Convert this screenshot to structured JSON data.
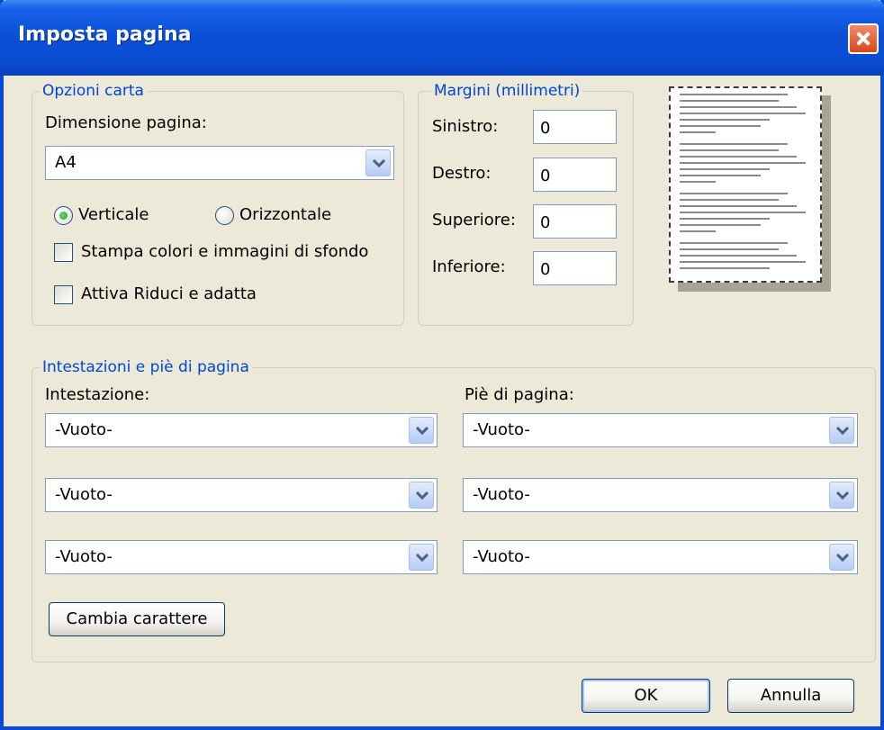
{
  "window": {
    "title": "Imposta pagina"
  },
  "paper": {
    "legend": "Opzioni carta",
    "size_label": "Dimensione pagina:",
    "size_value": "A4",
    "orientation": {
      "portrait": "Verticale",
      "landscape": "Orizzontale",
      "selected": "portrait"
    },
    "background_option": "Stampa colori e immagini di sfondo",
    "shrink_option": "Attiva Riduci e adatta"
  },
  "margins": {
    "legend": "Margini (millimetri)",
    "left_label": "Sinistro:",
    "left_value": "0",
    "right_label": "Destro:",
    "right_value": "0",
    "top_label": "Superiore:",
    "top_value": "0",
    "bottom_label": "Inferiore:",
    "bottom_value": "0"
  },
  "headers_footers": {
    "legend": "Intestazioni e piè di pagina",
    "header_label": "Intestazione:",
    "footer_label": "Piè di pagina:",
    "header_values": [
      "-Vuoto-",
      "-Vuoto-",
      "-Vuoto-"
    ],
    "footer_values": [
      "-Vuoto-",
      "-Vuoto-",
      "-Vuoto-"
    ],
    "font_button": "Cambia carattere"
  },
  "buttons": {
    "ok": "OK",
    "cancel": "Annulla"
  },
  "colors": {
    "title_bar": "#0a4fd6",
    "legend_text": "#0046d5",
    "dialog_bg": "#ece9d8",
    "close_button": "#d8481c"
  }
}
